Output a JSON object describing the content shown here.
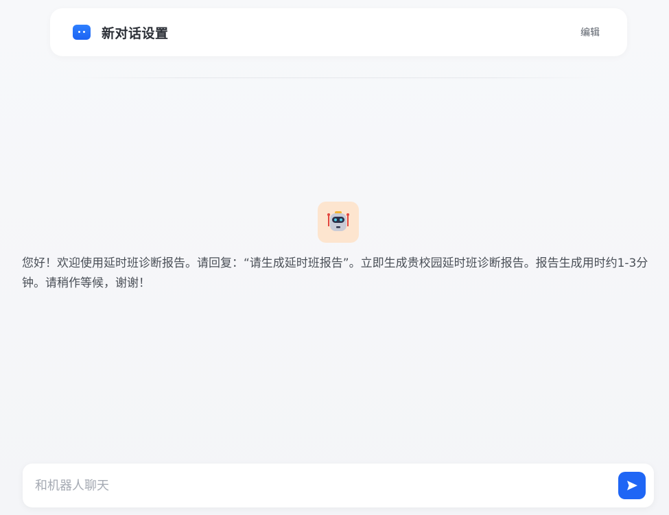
{
  "header": {
    "title": "新对话设置",
    "edit_label": "编辑",
    "icon": "chat-bubble-icon"
  },
  "conversation": {
    "bot_icon": "robot-icon",
    "welcome_message": "您好！欢迎使用延时班诊断报告。请回复：“请生成延时班报告”。立即生成贵校园延时班诊断报告。报告生成用时约1-3分钟。请稍作等候，谢谢！"
  },
  "composer": {
    "placeholder": "和机器人聊天",
    "value": "",
    "send_icon": "send-icon"
  },
  "colors": {
    "accent": "#1f66f5",
    "avatar_bg": "#fde5cf"
  }
}
